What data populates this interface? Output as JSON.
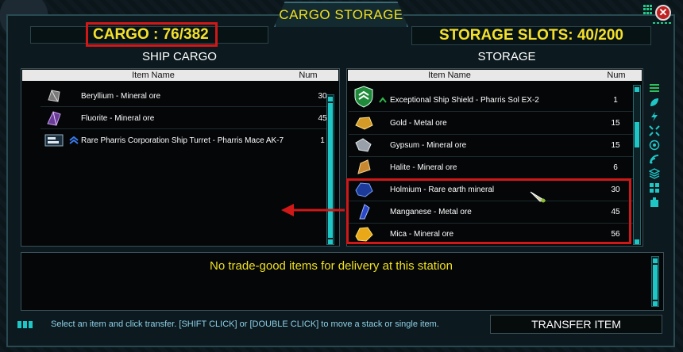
{
  "window": {
    "title": "CARGO STORAGE",
    "close_label": "✕"
  },
  "counters": {
    "cargo": "CARGO : 76/382",
    "storage_slots": "STORAGE SLOTS: 40/200"
  },
  "ship_cargo": {
    "title": "SHIP CARGO",
    "col_name": "Item Name",
    "col_num": "Num",
    "items": [
      {
        "name": "Beryllium - Mineral ore",
        "num": "30",
        "icon": "beryllium-ore-icon",
        "color": "#8a8a8a"
      },
      {
        "name": "Fluorite - Mineral ore",
        "num": "45",
        "icon": "fluorite-ore-icon",
        "color": "#9a6cc8"
      },
      {
        "name": "Rare Pharris Corporation Ship Turret - Pharris Mace AK-7",
        "num": "1",
        "icon": "ship-turret-icon",
        "color": "#9ab0c0"
      }
    ]
  },
  "storage": {
    "title": "STORAGE",
    "col_name": "Item Name",
    "col_num": "Num",
    "items": [
      {
        "name": "Exceptional Ship Shield - Pharris Sol EX-2",
        "num": "1",
        "icon": "ship-shield-icon",
        "color": "#2fb84a"
      },
      {
        "name": "Gold - Metal ore",
        "num": "15",
        "icon": "gold-ore-icon",
        "color": "#e0a830"
      },
      {
        "name": "Gypsum - Mineral ore",
        "num": "15",
        "icon": "gypsum-ore-icon",
        "color": "#b8bcc4"
      },
      {
        "name": "Halite - Mineral ore",
        "num": "6",
        "icon": "halite-ore-icon",
        "color": "#d8a040"
      },
      {
        "name": "Holmium - Rare earth mineral",
        "num": "30",
        "icon": "holmium-mineral-icon",
        "color": "#2a50c0"
      },
      {
        "name": "Manganese - Metal ore",
        "num": "45",
        "icon": "manganese-ore-icon",
        "color": "#3050d8"
      },
      {
        "name": "Mica - Mineral ore",
        "num": "56",
        "icon": "mica-ore-icon",
        "color": "#f0b020"
      }
    ]
  },
  "message": "No trade-good items for delivery at this station",
  "status_hint": "Select an item and click transfer. [SHIFT CLICK] or [DOUBLE CLICK] to move a stack or single item.",
  "transfer_button": "TRANSFER ITEM",
  "colors": {
    "accent_yellow": "#f0e020",
    "accent_cyan": "#1fc6c6",
    "highlight_red": "#d01818"
  }
}
